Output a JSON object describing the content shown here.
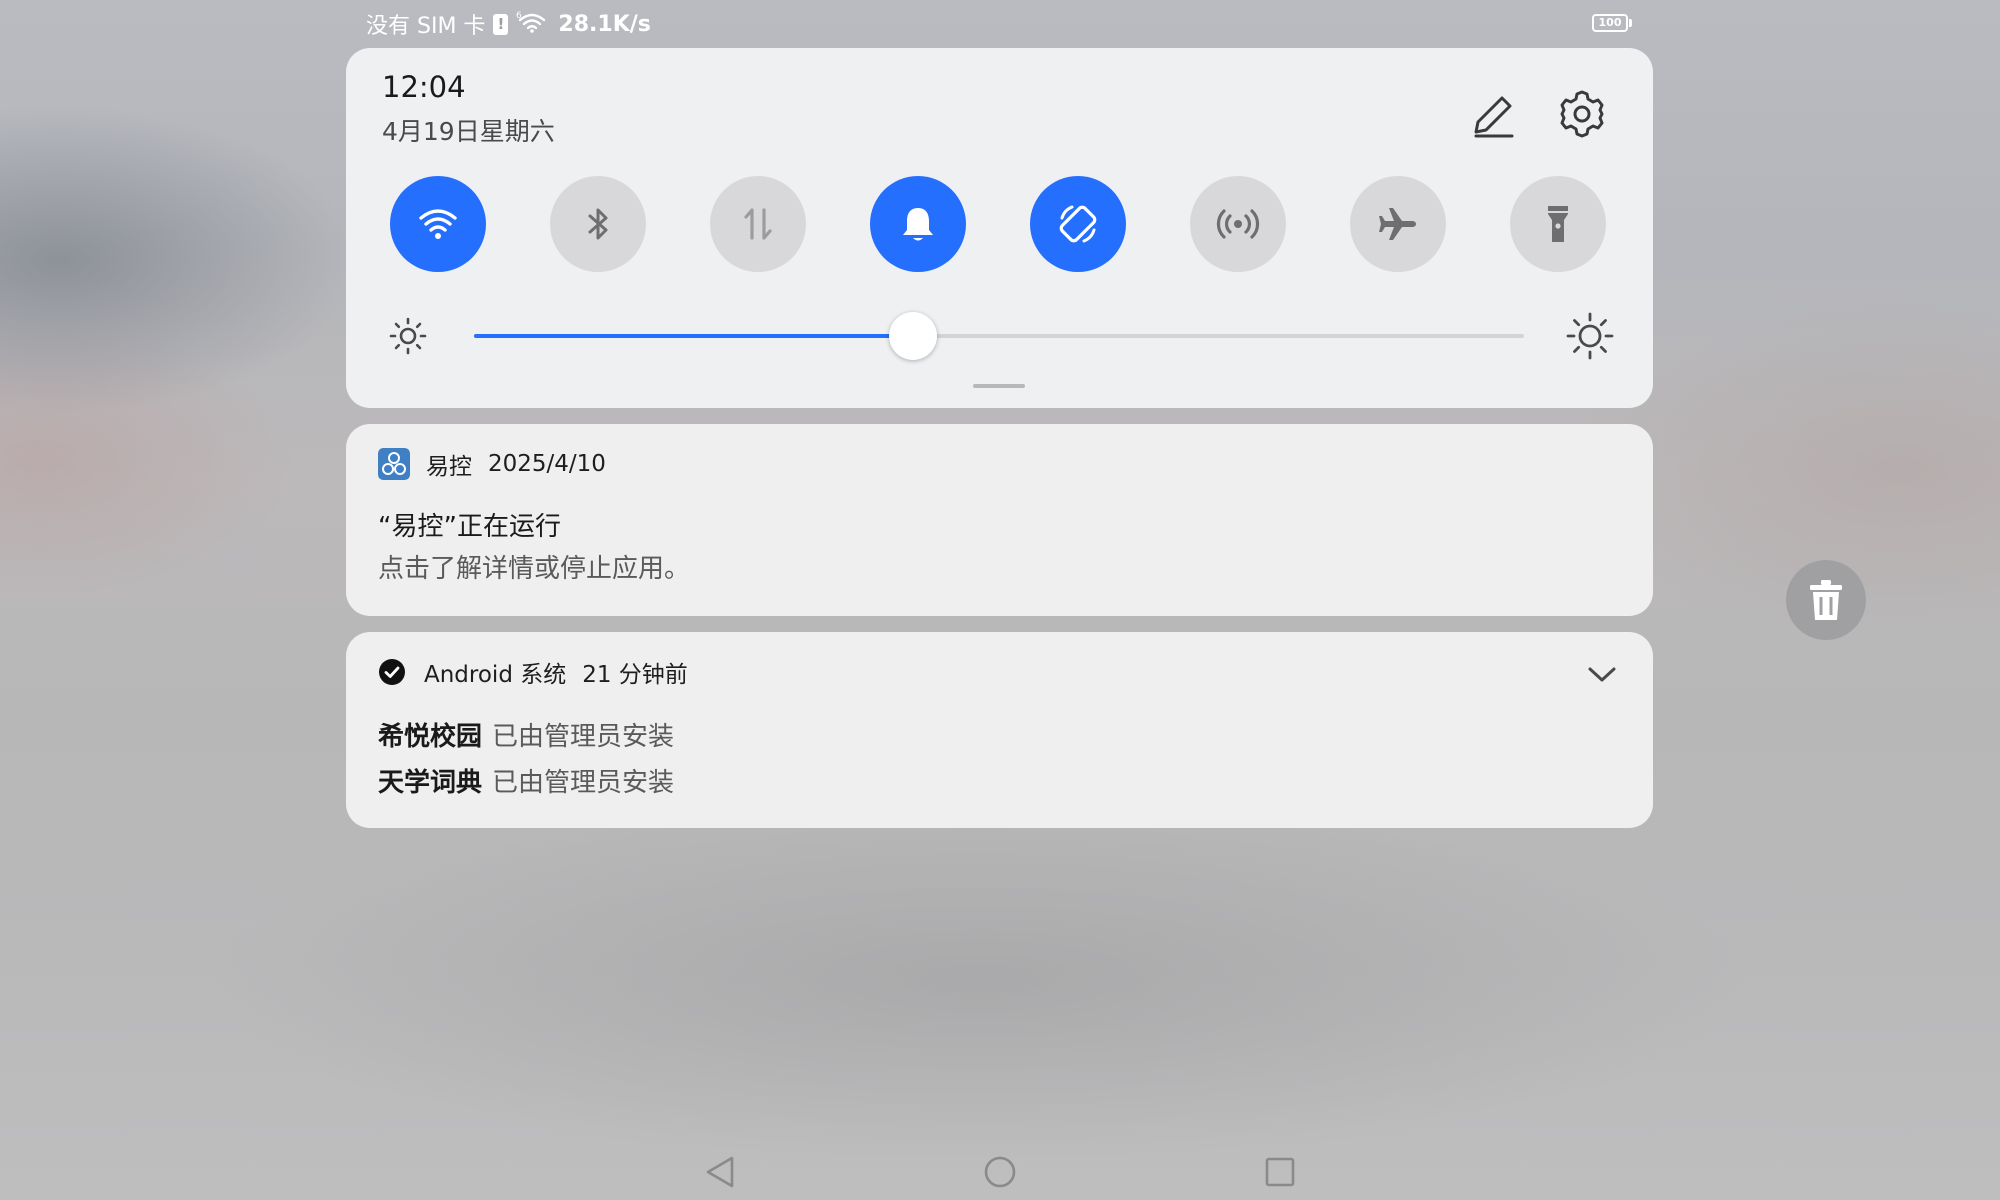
{
  "status_bar": {
    "sim_status": "没有 SIM 卡",
    "network_speed": "28.1K/s",
    "wifi_generation": "6",
    "battery": "100"
  },
  "quick_settings": {
    "time": "12:04",
    "date": "4月19日星期六",
    "toggles": [
      {
        "id": "wifi",
        "icon": "wifi-icon",
        "state": "on"
      },
      {
        "id": "bluetooth",
        "icon": "bluetooth-icon",
        "state": "off"
      },
      {
        "id": "mobile-data",
        "icon": "mobile-data-icon",
        "state": "off"
      },
      {
        "id": "sound",
        "icon": "bell-icon",
        "state": "on"
      },
      {
        "id": "auto-rotate",
        "icon": "auto-rotate-icon",
        "state": "on"
      },
      {
        "id": "hotspot",
        "icon": "hotspot-icon",
        "state": "off"
      },
      {
        "id": "airplane-mode",
        "icon": "airplane-icon",
        "state": "off"
      },
      {
        "id": "flashlight",
        "icon": "flashlight-icon",
        "state": "off"
      }
    ],
    "brightness_level": 0.418
  },
  "notifications": [
    {
      "app": "易控",
      "time": "2025/4/10",
      "title": "“易控”正在运行",
      "text": "点击了解详情或停止应用。"
    },
    {
      "app": "Android 系统",
      "time": "21 分钟前",
      "items": [
        {
          "app_name": "希悦校园",
          "status": "已由管理员安装"
        },
        {
          "app_name": "天学词典",
          "status": "已由管理员安装"
        }
      ]
    }
  ],
  "colors": {
    "accent": "#256fff",
    "toggle_off": "#d8d8da",
    "panel_background": "#f1f2f4"
  }
}
